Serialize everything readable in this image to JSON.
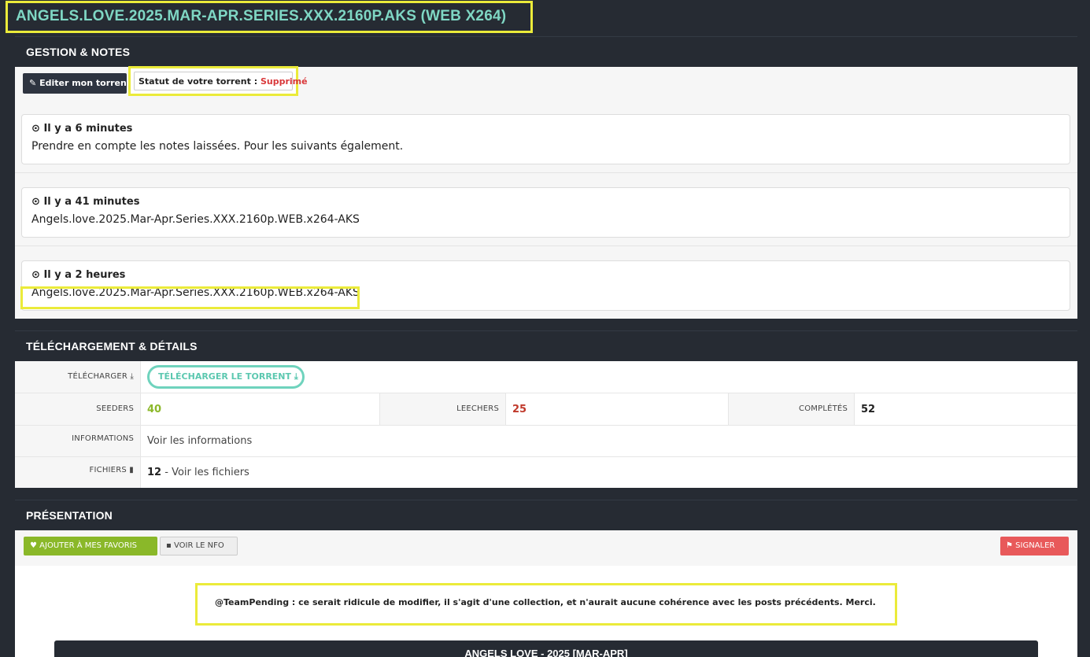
{
  "title": "ANGELS.LOVE.2025.MAR-APR.SERIES.XXX.2160P.AKS (WEB X264)",
  "gestion": {
    "header": "GESTION & NOTES",
    "edit_button": "Editer mon torrent",
    "status_label": "Statut de votre torrent :",
    "status_value": "Supprimé",
    "notes": [
      {
        "time": "Il y a 6 minutes",
        "text": "Prendre en compte les notes laissées. Pour les suivants également."
      },
      {
        "time": "Il y a 41 minutes",
        "text": "Angels.love.2025.Mar-Apr.Series.XXX.2160p.WEB.x264-AKS"
      },
      {
        "time": "Il y a 2 heures",
        "text": "Angels.love.2025.Mar-Apr.Series.XXX.2160p.WEB.x264-AKS"
      }
    ]
  },
  "download": {
    "header": "TÉLÉCHARGEMENT & DÉTAILS",
    "download_label": "TÉLÉCHARGER",
    "download_button": "TÉLÉCHARGER LE TORRENT",
    "seeders_label": "SEEDERS",
    "seeders": "40",
    "leechers_label": "LEECHERS",
    "leechers": "25",
    "completes_label": "COMPLÉTÉS",
    "completes": "52",
    "info_label": "INFORMATIONS",
    "info_link": "Voir les informations",
    "files_label": "FICHIERS",
    "files_count": "12",
    "files_link": "Voir les fichiers"
  },
  "presentation": {
    "header": "PRÉSENTATION",
    "fav_button": "AJOUTER À MES FAVORIS",
    "nfo_button": "VOIR LE NFO",
    "report_button": "SIGNALER",
    "message": "@TeamPending : ce serait ridicule de modifier, il s'agit d'une collection, et n'aurait aucune cohérence avec les posts précédents. Merci.",
    "bottom_title": "ANGELS LOVE - 2025 [MAR-APR]"
  },
  "colors": {
    "accent": "#7fd7c4",
    "highlight": "#ebeb3a",
    "danger": "#d9383a",
    "success": "#8cb82a"
  }
}
